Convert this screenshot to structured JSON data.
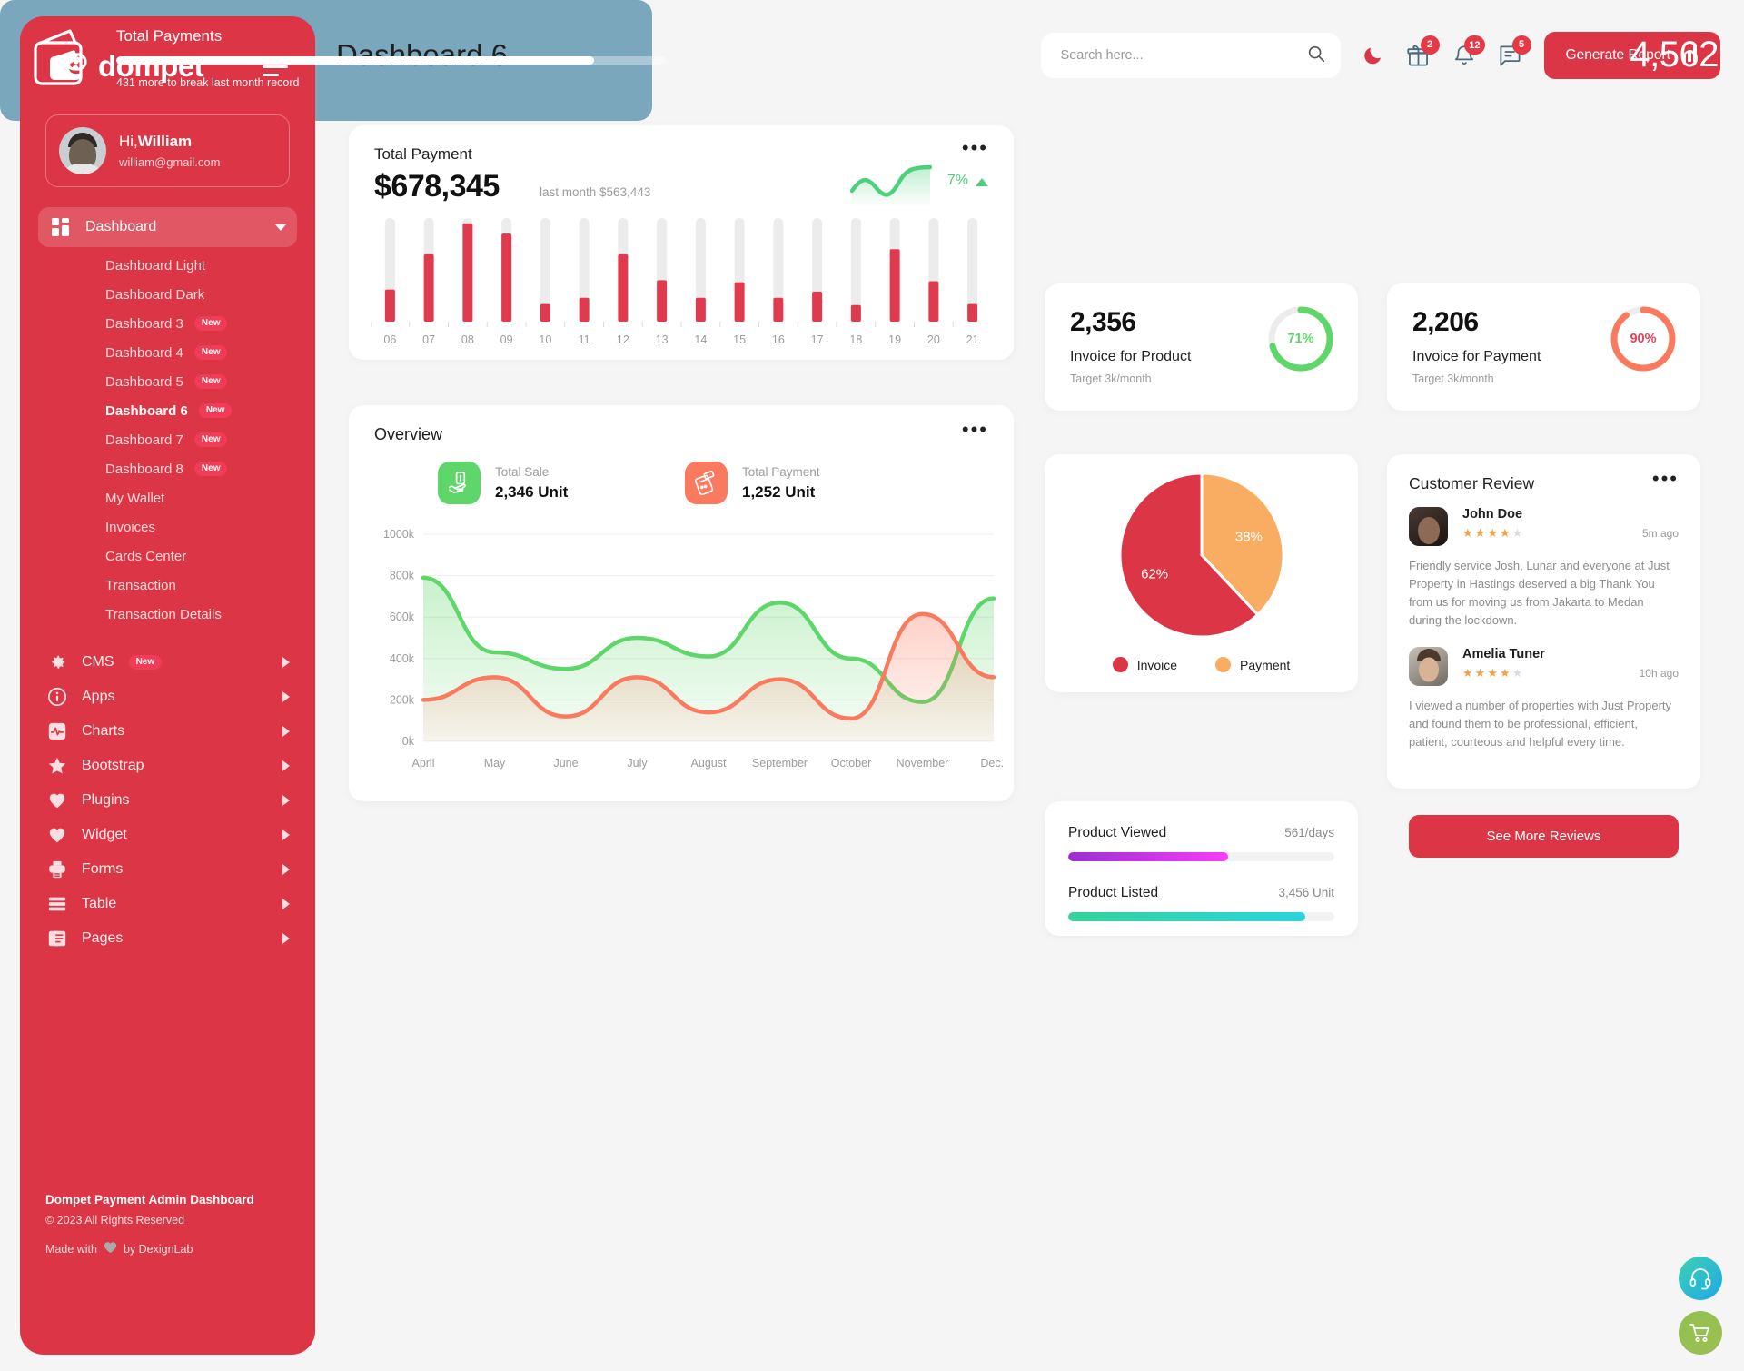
{
  "brand": {
    "name": "dompet",
    "logo_icon": "wallet-icon",
    "menu_icon": "hamburger-icon"
  },
  "profile": {
    "greeting_prefix": "Hi,",
    "name": "William",
    "email": "william@gmail.com"
  },
  "sidebar": {
    "dashboard": {
      "label": "Dashboard",
      "icon": "grid-icon"
    },
    "submenu": [
      {
        "label": "Dashboard Light",
        "badge": ""
      },
      {
        "label": "Dashboard Dark",
        "badge": ""
      },
      {
        "label": "Dashboard 3",
        "badge": "New"
      },
      {
        "label": "Dashboard 4",
        "badge": "New"
      },
      {
        "label": "Dashboard 5",
        "badge": "New"
      },
      {
        "label": "Dashboard 6",
        "badge": "New"
      },
      {
        "label": "Dashboard 7",
        "badge": "New"
      },
      {
        "label": "Dashboard 8",
        "badge": "New"
      },
      {
        "label": "My Wallet",
        "badge": ""
      },
      {
        "label": "Invoices",
        "badge": ""
      },
      {
        "label": "Cards Center",
        "badge": ""
      },
      {
        "label": "Transaction",
        "badge": ""
      },
      {
        "label": "Transaction Details",
        "badge": ""
      }
    ],
    "sections": [
      {
        "label": "CMS",
        "icon": "gear-icon",
        "badge": "New"
      },
      {
        "label": "Apps",
        "icon": "info-icon",
        "badge": ""
      },
      {
        "label": "Charts",
        "icon": "chart-icon",
        "badge": ""
      },
      {
        "label": "Bootstrap",
        "icon": "star-icon",
        "badge": ""
      },
      {
        "label": "Plugins",
        "icon": "heart-icon",
        "badge": ""
      },
      {
        "label": "Widget",
        "icon": "heart-icon",
        "badge": ""
      },
      {
        "label": "Forms",
        "icon": "printer-icon",
        "badge": ""
      },
      {
        "label": "Table",
        "icon": "table-icon",
        "badge": ""
      },
      {
        "label": "Pages",
        "icon": "pages-icon",
        "badge": ""
      }
    ],
    "footer": {
      "title": "Dompet Payment Admin Dashboard",
      "copyright": "© 2023 All Rights Reserved",
      "made_prefix": "Made with",
      "made_suffix": "by DexignLab"
    }
  },
  "header": {
    "page_title": "Dashboard 6",
    "search_placeholder": "Search here...",
    "search_value": "",
    "search_icon": "search-icon",
    "dark_mode_icon": "moon-icon",
    "gift_icon": "gift-icon",
    "gift_badge": "2",
    "bell_icon": "bell-icon",
    "bell_badge": "12",
    "message_icon": "message-icon",
    "message_badge": "5",
    "generate_report_label": "Generate Report",
    "generate_report_icon": "bar-chart-icon",
    "accent_color": "#dc3545"
  },
  "total_payment": {
    "title": "Total Payment",
    "amount": "$678,345",
    "last_month": "last month $563,443",
    "percent": "7%",
    "trend": "up",
    "trend_color": "#4cd07d"
  },
  "total_payments_banner": {
    "label": "Total Payments",
    "value": "4,562",
    "note": "431 more to break last month record",
    "progress_percent": 87,
    "bg_color": "#7ba7bc",
    "icon": "wallet-icon"
  },
  "invoice_cards": [
    {
      "value": "2,356",
      "label": "Invoice for Product",
      "target": "Target 3k/month",
      "percent": "71%",
      "percent_value": 71,
      "color": "#5fd669"
    },
    {
      "value": "2,206",
      "label": "Invoice for Payment",
      "target": "Target 3k/month",
      "percent": "90%",
      "percent_value": 90,
      "color": "#fa7a5f"
    }
  ],
  "overview": {
    "title": "Overview",
    "tiles": [
      {
        "caption": "Total Sale",
        "value": "2,346 Unit",
        "icon": "hand-money-icon",
        "color": "#5fd669"
      },
      {
        "caption": "Total Payment",
        "value": "1,252 Unit",
        "icon": "card-terminal-icon",
        "color": "#fa7a5f"
      }
    ]
  },
  "pie_card": {
    "legend": [
      {
        "label": "Invoice",
        "color": "#dc3545"
      },
      {
        "label": "Payment",
        "color": "#f9ad63"
      }
    ]
  },
  "progress_card": {
    "rows": [
      {
        "name": "Product Viewed",
        "value": "561/days",
        "percent": 60,
        "color_from": "#9b2fd1",
        "color_to": "#f83df8"
      },
      {
        "name": "Product Listed",
        "value": "3,456 Unit",
        "percent": 89,
        "color_from": "#34d399",
        "color_to": "#2ad4dd"
      }
    ]
  },
  "customer_review": {
    "title": "Customer Review",
    "button_label": "See More Reviews",
    "reviews": [
      {
        "name": "John Doe",
        "stars": 4,
        "max_stars": 5,
        "ago": "5m ago",
        "text": "Friendly service Josh, Lunar and everyone at Just Property in Hastings deserved a big Thank You from us for moving us from Jakarta to Medan during the lockdown."
      },
      {
        "name": "Amelia Tuner",
        "stars": 4,
        "max_stars": 5,
        "ago": "10h ago",
        "text": "I viewed a number of properties with Just Property and found them to be professional, efficient, patient, courteous and helpful every time."
      }
    ]
  },
  "fabs": [
    {
      "icon": "headset-icon",
      "name": "support"
    },
    {
      "icon": "cart-icon",
      "name": "cart"
    }
  ],
  "chart_data": [
    {
      "type": "bar",
      "title": "Total Payment",
      "categories": [
        "06",
        "07",
        "08",
        "09",
        "10",
        "11",
        "12",
        "13",
        "14",
        "15",
        "16",
        "17",
        "18",
        "19",
        "20",
        "21"
      ],
      "values": [
        31,
        65,
        95,
        85,
        17,
        23,
        65,
        40,
        23,
        38,
        23,
        29,
        16,
        70,
        39,
        17
      ],
      "track_max": 100,
      "bar_color": "#e03a4e",
      "track_color": "#ececec",
      "xlabel": "",
      "ylabel": "",
      "ylim": [
        0,
        100
      ],
      "grid": false
    },
    {
      "type": "area",
      "title": "Overview",
      "x": [
        "April",
        "May",
        "June",
        "July",
        "August",
        "September",
        "October",
        "November",
        "Dec.."
      ],
      "series": [
        {
          "name": "Total Sale",
          "color": "#5fd669",
          "values": [
            790,
            430,
            350,
            500,
            410,
            670,
            400,
            190,
            690
          ]
        },
        {
          "name": "Total Payment",
          "color": "#fa7a5f",
          "values": [
            200,
            310,
            120,
            310,
            140,
            300,
            110,
            615,
            310
          ]
        }
      ],
      "yticks": [
        "0k",
        "200k",
        "400k",
        "600k",
        "800k",
        "1000k"
      ],
      "ylim": [
        0,
        1000
      ],
      "xlabel": "",
      "ylabel": "",
      "grid": true,
      "legend": "none"
    },
    {
      "type": "pie",
      "title": "",
      "labels": [
        "Invoice",
        "Payment"
      ],
      "values": [
        62,
        38
      ],
      "value_labels": [
        "62%",
        "38%"
      ],
      "colors": [
        "#dc3545",
        "#f9ad63"
      ],
      "legend": "bottom"
    }
  ]
}
